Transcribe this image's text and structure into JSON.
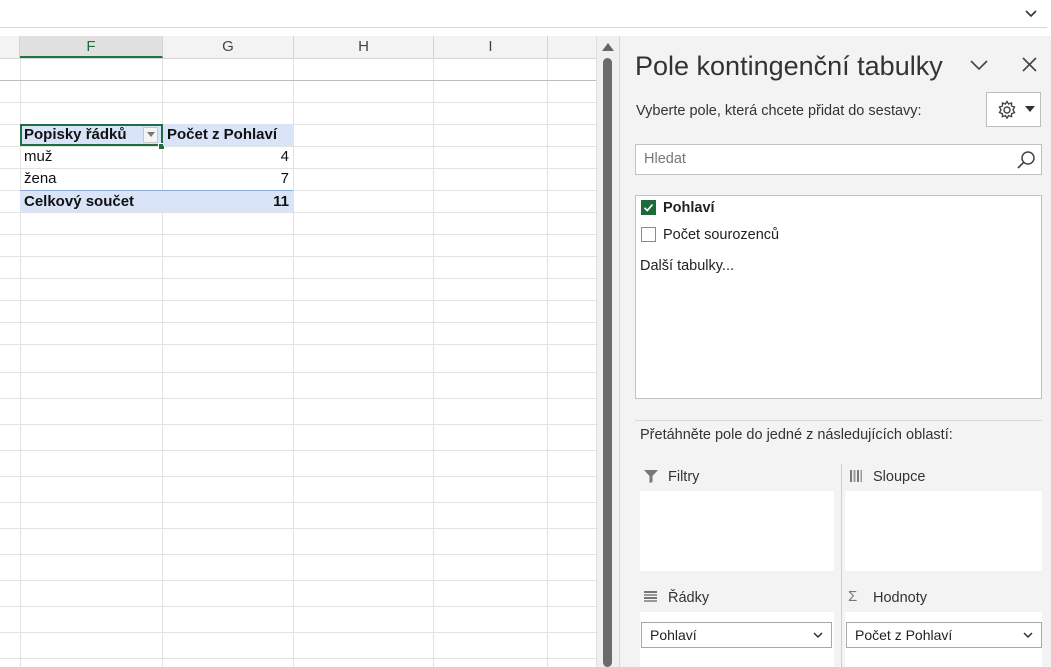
{
  "columns": [
    "F",
    "G",
    "H",
    "I"
  ],
  "active_column": "F",
  "pivot": {
    "header_row_labels": "Popisky řádků",
    "header_values": "Počet z Pohlaví",
    "rows": [
      {
        "label": "muž",
        "value": "4"
      },
      {
        "label": "žena",
        "value": "7"
      }
    ],
    "total_label": "Celkový součet",
    "total_value": "11"
  },
  "panel": {
    "title": "Pole kontingenční tabulky",
    "choose_fields_label": "Vyberte pole, která chcete přidat do sestavy:",
    "search_placeholder": "Hledat",
    "fields": [
      {
        "label": "Pohlaví",
        "checked": true
      },
      {
        "label": "Počet sourozenců",
        "checked": false
      }
    ],
    "more_tables": "Další tabulky...",
    "drag_hint": "Přetáhněte pole do jedné z následujících oblastí:",
    "areas": {
      "filters": {
        "title": "Filtry",
        "items": []
      },
      "columns": {
        "title": "Sloupce",
        "items": []
      },
      "rows": {
        "title": "Řádky",
        "items": [
          "Pohlaví"
        ]
      },
      "values": {
        "title": "Hodnoty",
        "items": [
          "Počet z Pohlaví"
        ]
      }
    }
  },
  "icons": {
    "formula_bar": "chevron-down-icon",
    "panel_collapse": "chevron-down-icon",
    "panel_close": "close-icon",
    "settings": "gear-icon",
    "search": "search-icon",
    "filter": "filter-icon",
    "columns": "columns-icon",
    "rows": "rows-icon",
    "values": "sigma-icon"
  },
  "colors": {
    "accent": "#1e6b3a",
    "pivot_header_fill": "#d9e4f8",
    "panel_background": "#f3f3f3"
  }
}
